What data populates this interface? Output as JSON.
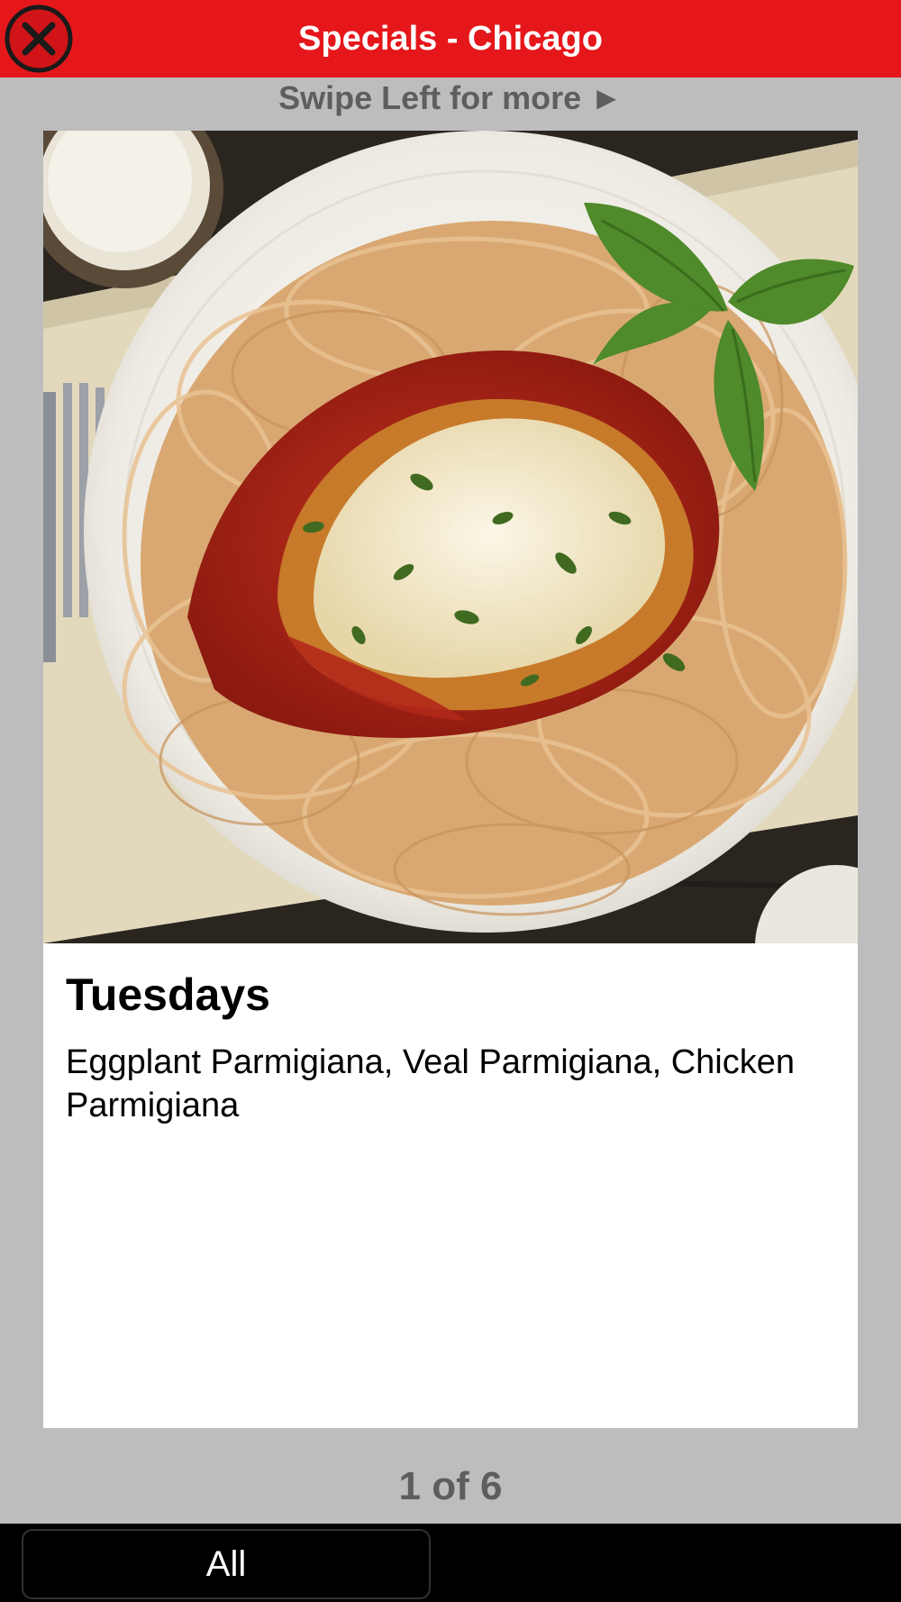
{
  "header": {
    "title": "Specials - Chicago",
    "close_icon": "close-circle-icon",
    "background_color": "#e5171b"
  },
  "swipe_hint": "Swipe Left for more ►",
  "special": {
    "image_alt": "Chicken parmigiana over spaghetti with basil",
    "title": "Tuesdays",
    "description": "Eggplant Parmigiana, Veal Parmigiana, Chicken Parmigiana"
  },
  "pager": {
    "text": "1 of 6"
  },
  "bottom_bar": {
    "filter_label": "All"
  }
}
